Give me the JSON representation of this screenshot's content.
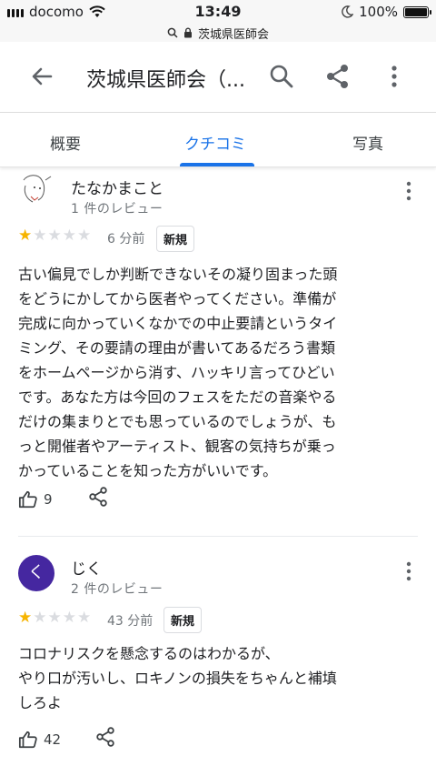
{
  "status": {
    "carrier": "docomo",
    "time": "13:49",
    "battery": "100%"
  },
  "url": {
    "text": "茨城県医師会"
  },
  "appbar": {
    "title": "茨城県医師会（..."
  },
  "tabs": [
    {
      "label": "概要"
    },
    {
      "label": "クチコミ"
    },
    {
      "label": "写真"
    }
  ],
  "reviews": [
    {
      "name": "たなかまこと",
      "count": "1 件のレビュー",
      "rating": 1,
      "time": "6 分前",
      "badge": "新規",
      "text": "古い偏見でしか判断できないその凝り固まった頭\nをどうにかしてから医者やってください。準備が\n完成に向かっていくなかでの中止要請というタイ\nミング、その要請の理由が書いてあるだろう書類\nをホームページから消す、ハッキリ言ってひどい\nです。あなた方は今回のフェスをただの音楽やる\nだけの集まりとでも思っているのでしょうが、も\nっと開催者やアーティスト、観客の気持ちが乗っ\nかっていることを知った方がいいです。",
      "likes": "9"
    },
    {
      "name": "じく",
      "avatar_letter": "く",
      "avatar_color": "#4527a0",
      "count": "2 件のレビュー",
      "rating": 1,
      "time": "43 分前",
      "badge": "新規",
      "text": "コロナリスクを懸念するのはわかるが、\nやり口が汚いし、ロキノンの損失をちゃんと補填\nしろよ",
      "likes": "42"
    }
  ],
  "colors": {
    "accent": "#1a73e8",
    "star": "#f6b400"
  },
  "icons": [
    "back-arrow-icon",
    "search-icon",
    "share-icon",
    "more-vert-icon",
    "thumb-up-icon",
    "lock-icon",
    "wifi-icon",
    "moon-icon"
  ]
}
